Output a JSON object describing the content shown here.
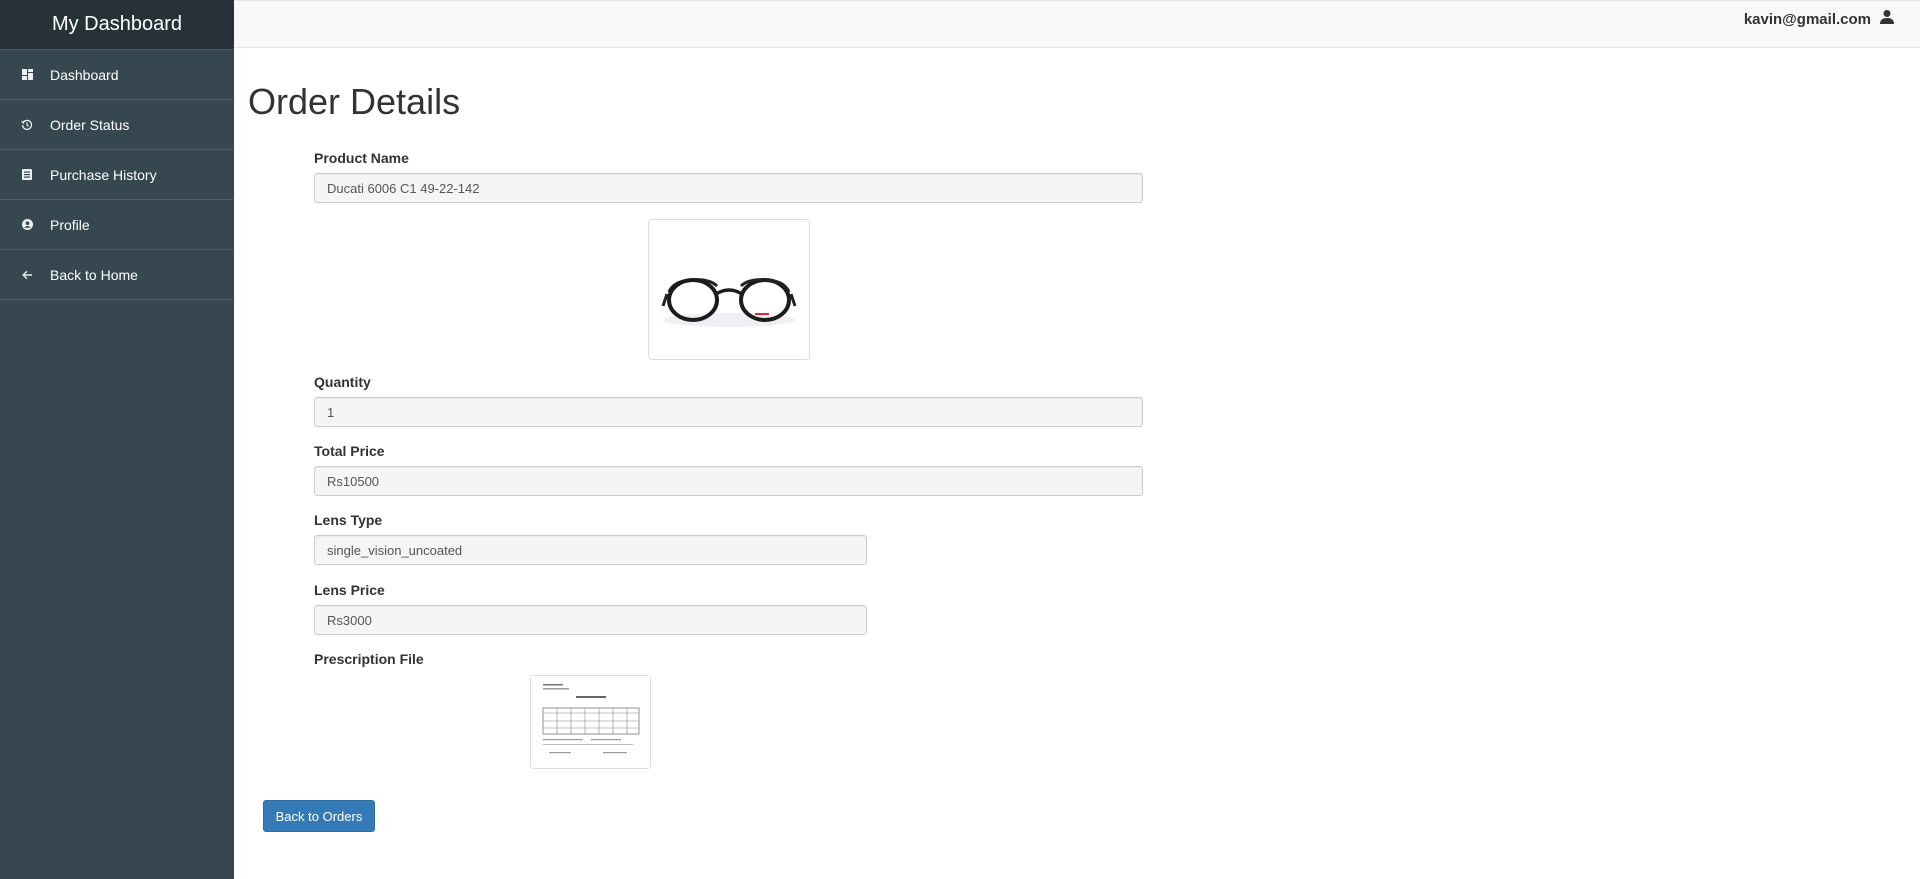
{
  "sidebar": {
    "brand": "My Dashboard",
    "items": [
      {
        "label": "Dashboard",
        "icon": "dashboard-icon"
      },
      {
        "label": "Order Status",
        "icon": "history-icon"
      },
      {
        "label": "Purchase History",
        "icon": "list-icon"
      },
      {
        "label": "Profile",
        "icon": "user-circle-icon"
      },
      {
        "label": "Back to Home",
        "icon": "arrow-left-icon"
      }
    ]
  },
  "header": {
    "user_email": "kavin@gmail.com",
    "user_icon": "user-icon"
  },
  "main": {
    "title": "Order Details",
    "fields": {
      "product_name": {
        "label": "Product Name",
        "value": "Ducati 6006 C1 49-22-142"
      },
      "quantity": {
        "label": "Quantity",
        "value": "1"
      },
      "total_price": {
        "label": "Total Price",
        "value": "Rs10500"
      },
      "lens_type": {
        "label": "Lens Type",
        "value": "single_vision_uncoated"
      },
      "lens_price": {
        "label": "Lens Price",
        "value": "Rs3000"
      },
      "prescription_file": {
        "label": "Prescription File"
      }
    },
    "back_button": "Back to Orders"
  },
  "colors": {
    "sidebar_bg": "#37474f",
    "brand_bg": "#263238",
    "primary_button": "#337ab7"
  }
}
